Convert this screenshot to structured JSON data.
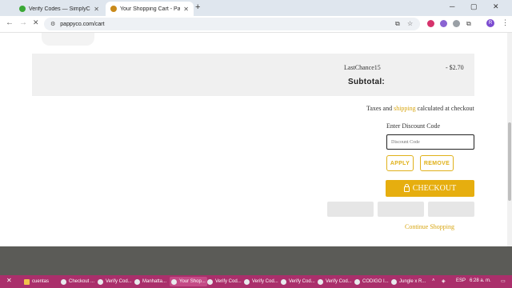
{
  "browser": {
    "tabs": [
      {
        "title": "Verify Codes — SimplyCodes",
        "favicon_color": "#3aa835",
        "active": false
      },
      {
        "title": "Your Shopping Cart - Pappy & C",
        "favicon_color": "#c98a1a",
        "active": true
      }
    ],
    "new_tab_symbol": "+",
    "url": "pappyco.com/cart",
    "profile_initial": "R",
    "window_controls": [
      "─",
      "▢",
      "✕"
    ]
  },
  "cart": {
    "discount_code": "LastChance15",
    "discount_amount": "- $2.70",
    "subtotal_label": "Subtotal:",
    "taxes_prefix": "Taxes and",
    "taxes_link": "shipping",
    "taxes_suffix": "calculated at checkout",
    "enter_discount_label": "Enter Discount Code",
    "discount_placeholder": "Discount Code",
    "apply_label": "APPLY",
    "remove_label": "REMOVE",
    "checkout_label": "CHECKOUT",
    "continue_label": "Continue Shopping"
  },
  "taskbar": {
    "items": [
      "cuentas",
      "Checkout ...",
      "Verify Cod...",
      "Manhatta...",
      "Your Shop...",
      "Verify Cod...",
      "Verify Cod...",
      "Verify Cod...",
      "Verify Cod...",
      "CODIGO I...",
      "Jungle x R..."
    ],
    "active_index": 4,
    "language": "ESP",
    "time": "6:28 a. m."
  },
  "colors": {
    "accent": "#e6ae0f",
    "link": "#d8a613",
    "taskbar": "#aa2f6b",
    "footer": "#5b5b57"
  }
}
